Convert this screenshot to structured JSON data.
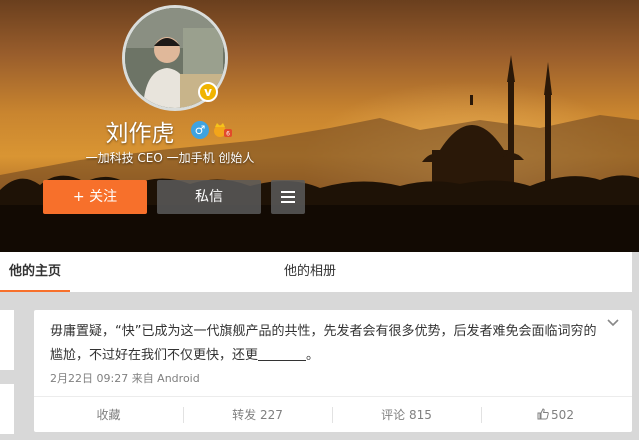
{
  "profile": {
    "name": "刘作虎",
    "gender_icon": "♂",
    "bio": "一加科技 CEO 一加手机 创始人",
    "verified_icon": "v-verified-badge",
    "vip_icon": "vip-crown-icon"
  },
  "actions": {
    "follow_label": "+ 关注",
    "message_label": "私信",
    "more_icon": "menu-icon"
  },
  "tabs": [
    {
      "label": "他的主页",
      "active": true
    },
    {
      "label": "他的相册",
      "active": false
    }
  ],
  "post": {
    "text_before": "毋庸置疑，“快”已成为这一代旗舰产品的共性，先发者会有很多优势，后发者难免会面临词穷的尴尬，不过好在我们不仅更快，还更",
    "text_after": "。",
    "meta": "2月22日 09:27 来自 Android",
    "footer": {
      "favorite": "收藏",
      "forward": "转发 227",
      "comment": "评论 815",
      "like": "502"
    }
  },
  "colors": {
    "accent": "#f7702b",
    "gender": "#3fa3e0",
    "verified": "#f0b400"
  }
}
